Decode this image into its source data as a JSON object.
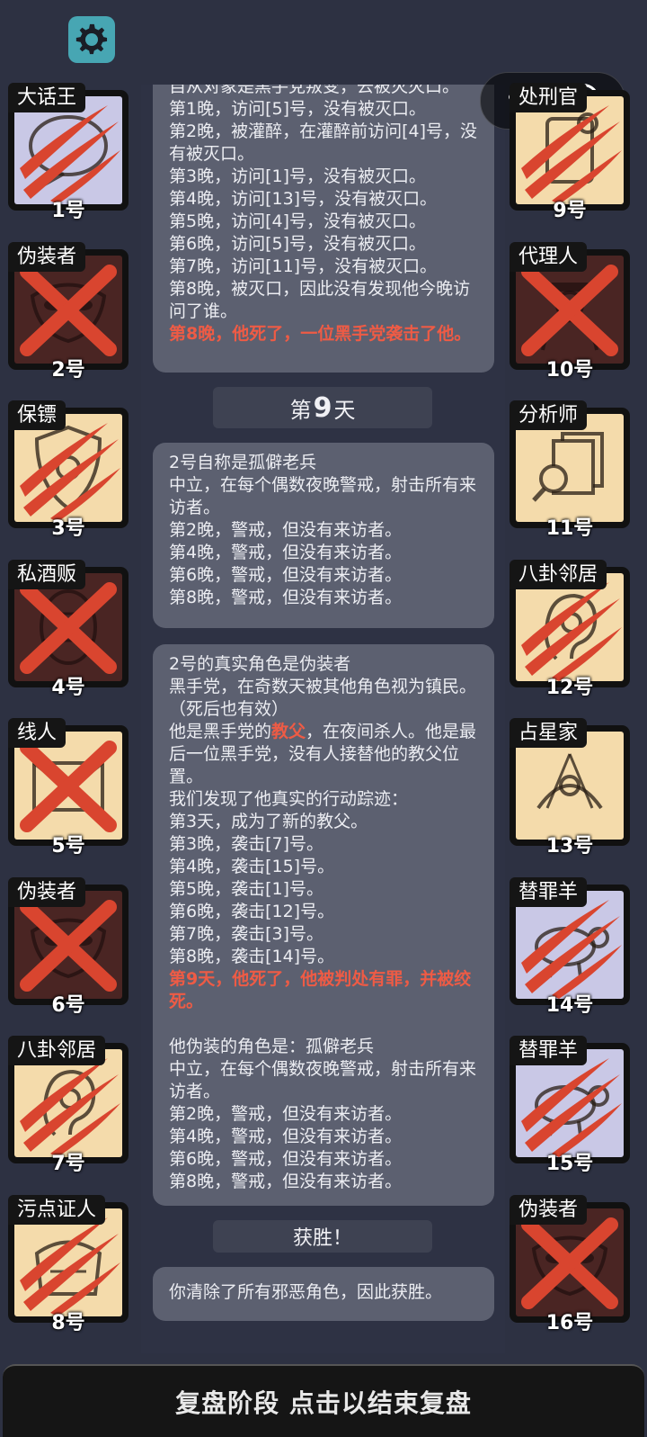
{
  "header": {
    "capsule_label": "处刑官"
  },
  "players": [
    {
      "num": "1号",
      "role": "大话王",
      "bg": "lav",
      "mark": "claw",
      "icon": "speech-bubble-icon"
    },
    {
      "num": "2号",
      "role": "伪装者",
      "bg": "dark",
      "mark": "x",
      "icon": "mask-icon"
    },
    {
      "num": "3号",
      "role": "保镖",
      "bg": "beige",
      "mark": "claw",
      "icon": "shield-icon"
    },
    {
      "num": "4号",
      "role": "私酒贩",
      "bg": "dark",
      "mark": "x",
      "icon": "barrel-icon"
    },
    {
      "num": "5号",
      "role": "线人",
      "bg": "beige",
      "mark": "x",
      "icon": "envelope-icon"
    },
    {
      "num": "6号",
      "role": "伪装者",
      "bg": "dark",
      "mark": "x",
      "icon": "mask-icon"
    },
    {
      "num": "7号",
      "role": "八卦邻居",
      "bg": "beige",
      "mark": "claw",
      "icon": "ear-icon"
    },
    {
      "num": "8号",
      "role": "污点证人",
      "bg": "beige",
      "mark": "claw",
      "icon": "witness-icon"
    },
    {
      "num": "9号",
      "role": "处刑官",
      "bg": "beige",
      "mark": "claw",
      "icon": "scroll-icon"
    },
    {
      "num": "10号",
      "role": "代理人",
      "bg": "dark",
      "mark": "x",
      "icon": "agent-icon"
    },
    {
      "num": "11号",
      "role": "分析师",
      "bg": "beige",
      "mark": "none",
      "icon": "documents-magnifier-icon"
    },
    {
      "num": "12号",
      "role": "八卦邻居",
      "bg": "beige",
      "mark": "claw",
      "icon": "ear-icon"
    },
    {
      "num": "13号",
      "role": "占星家",
      "bg": "beige",
      "mark": "none",
      "icon": "sextant-icon"
    },
    {
      "num": "14号",
      "role": "替罪羊",
      "bg": "lav",
      "mark": "claw",
      "icon": "sheep-icon"
    },
    {
      "num": "15号",
      "role": "替罪羊",
      "bg": "lav",
      "mark": "claw",
      "icon": "sheep-icon"
    },
    {
      "num": "16号",
      "role": "伪装者",
      "bg": "dark",
      "mark": "x",
      "icon": "mask-icon"
    }
  ],
  "log": {
    "card1": [
      {
        "t": "自从对象是黑手党叛变，去被灭灭口。",
        "red": false
      },
      {
        "t": "第1晚，访问[5]号，没有被灭口。",
        "red": false
      },
      {
        "t": "第2晚，被灌醉，在灌醉前访问[4]号，没有被灭口。",
        "red": false
      },
      {
        "t": "第3晚，访问[1]号，没有被灭口。",
        "red": false
      },
      {
        "t": "第4晚，访问[13]号，没有被灭口。",
        "red": false
      },
      {
        "t": "第5晚，访问[4]号，没有被灭口。",
        "red": false
      },
      {
        "t": "第6晚，访问[5]号，没有被灭口。",
        "red": false
      },
      {
        "t": "第7晚，访问[11]号，没有被灭口。",
        "red": false
      },
      {
        "t": "第8晚，被灭口，因此没有发现他今晚访问了谁。",
        "red": false
      },
      {
        "t": "第8晚，他死了，一位黑手党袭击了他。",
        "red": true
      }
    ],
    "day_prefix": "第",
    "day_number": "9",
    "day_suffix": "天",
    "card2": [
      {
        "t": "2号自称是孤僻老兵",
        "red": false
      },
      {
        "t": "中立，在每个偶数夜晚警戒，射击所有来访者。",
        "red": false
      },
      {
        "t": "第2晚，警戒，但没有来访者。",
        "red": false
      },
      {
        "t": "第4晚，警戒，但没有来访者。",
        "red": false
      },
      {
        "t": "第6晚，警戒，但没有来访者。",
        "red": false
      },
      {
        "t": "第8晚，警戒，但没有来访者。",
        "red": false
      }
    ],
    "card3": {
      "lines_before": [
        {
          "t": "2号的真实角色是伪装者",
          "red": false
        },
        {
          "t": "黑手党，在奇数天被其他角色视为镇民。（死后也有效）",
          "red": false
        }
      ],
      "godfather_pre": "他是黑手党的",
      "godfather_word": "教父",
      "godfather_post": "，在夜间杀人。他是最后一位黑手党，没有人接替他的教父位置。",
      "lines_after": [
        {
          "t": "我们发现了他真实的行动踪迹：",
          "red": false
        },
        {
          "t": "第3天，成为了新的教父。",
          "red": false
        },
        {
          "t": "第3晚，袭击[7]号。",
          "red": false
        },
        {
          "t": "第4晚，袭击[15]号。",
          "red": false
        },
        {
          "t": "第5晚，袭击[1]号。",
          "red": false
        },
        {
          "t": "第6晚，袭击[12]号。",
          "red": false
        },
        {
          "t": "第7晚，袭击[3]号。",
          "red": false
        },
        {
          "t": "第8晚，袭击[14]号。",
          "red": false
        },
        {
          "t": "第9天，他死了，他被判处有罪，并被绞死。",
          "red": true
        },
        {
          "t": "",
          "red": false
        },
        {
          "t": "他伪装的角色是：孤僻老兵",
          "red": false
        },
        {
          "t": "中立，在每个偶数夜晚警戒，射击所有来访者。",
          "red": false
        },
        {
          "t": "第2晚，警戒，但没有来访者。",
          "red": false
        },
        {
          "t": "第4晚，警戒，但没有来访者。",
          "red": false
        },
        {
          "t": "第6晚，警戒，但没有来访者。",
          "red": false
        },
        {
          "t": "第8晚，警戒，但没有来访者。",
          "red": false
        }
      ]
    },
    "win_label": "获胜！",
    "win_text": "你清除了所有邪恶角色，因此获胜。"
  },
  "footer": {
    "label": "复盘阶段 点击以结束复盘"
  },
  "colors": {
    "background": "#2d3142",
    "card_panel": "#5c6070",
    "highlight_red": "#ee5b45",
    "claw_red": "#d9452f",
    "gear_teal": "#47a6b3"
  }
}
